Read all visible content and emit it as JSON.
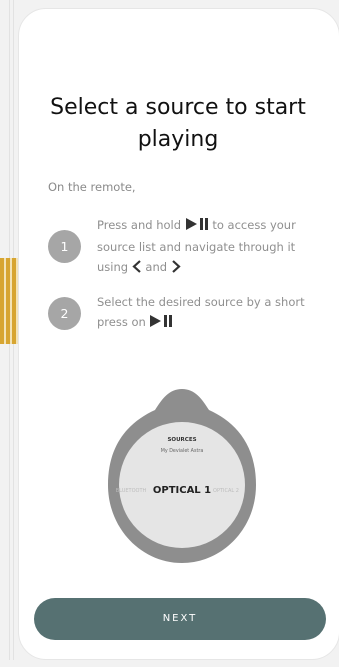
{
  "screen": {
    "title": "Select a source to start playing",
    "intro": "On the remote,"
  },
  "steps": [
    {
      "number": "1",
      "text_part1": "Press and hold",
      "text_part2": "to access your source list and navigate through it using",
      "text_part3": "and"
    },
    {
      "number": "2",
      "text_part1": "Select the desired source by a short press on"
    }
  ],
  "remote_display": {
    "header": "SOURCES",
    "device": "My Devialet Astra",
    "current": "OPTICAL 1",
    "prev": "BLUETOOTH",
    "next": "OPTICAL 2"
  },
  "actions": {
    "next_label": "NEXT"
  },
  "colors": {
    "accent": "#d7a531",
    "button": "#567172",
    "remote_ring": "#8e8e8e",
    "remote_face": "#e5e5e5"
  },
  "icons": [
    "play-pause-icon",
    "chevron-left-icon",
    "chevron-right-icon"
  ]
}
